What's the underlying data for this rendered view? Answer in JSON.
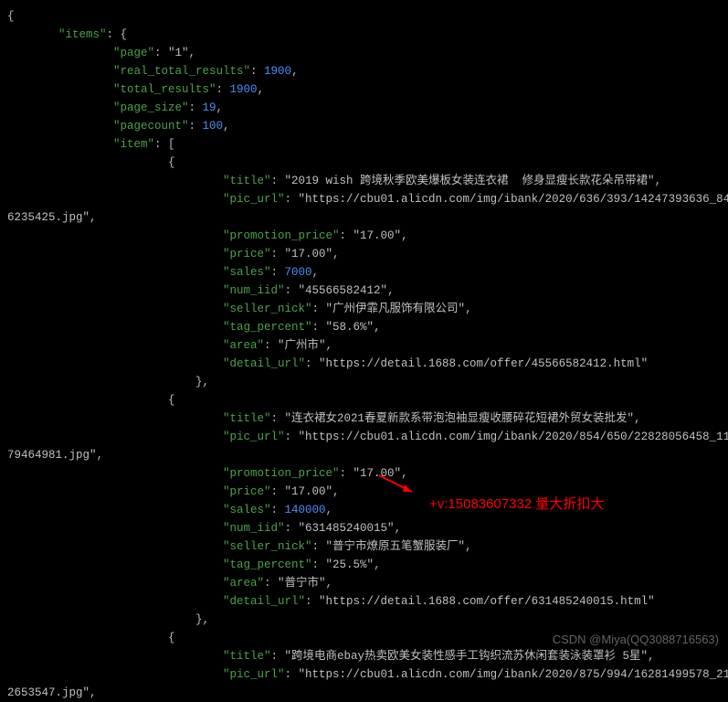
{
  "root": {
    "open": "{",
    "items_key": "\"items\"",
    "colon_obj": ": {",
    "page_key": "\"page\"",
    "page_val": "\"1\"",
    "rtr_key": "\"real_total_results\"",
    "rtr_val": "1900",
    "tr_key": "\"total_results\"",
    "tr_val": "1900",
    "ps_key": "\"page_size\"",
    "ps_val": "19",
    "pc_key": "\"pagecount\"",
    "pc_val": "100",
    "item_key": "\"item\"",
    "arr_open": ": [",
    "obj_open": "{",
    "obj_close": "},"
  },
  "item1": {
    "title_k": "\"title\"",
    "title_v": "\"2019 wish 跨境秋季欧美爆板女装连衣裙  修身显瘦长款花朵吊带裙\"",
    "pic_k": "\"pic_url\"",
    "pic_v1": "\"https://cbu01.alicdn.com/img/ibank/2020/636/393/14247393636_84",
    "pic_v2": "6235425.jpg\"",
    "pp_k": "\"promotion_price\"",
    "pp_v": "\"17.00\"",
    "price_k": "\"price\"",
    "price_v": "\"17.00\"",
    "sales_k": "\"sales\"",
    "sales_v": "7000",
    "numiid_k": "\"num_iid\"",
    "numiid_v": "\"45566582412\"",
    "sn_k": "\"seller_nick\"",
    "sn_v": "\"广州伊霏凡服饰有限公司\"",
    "tp_k": "\"tag_percent\"",
    "tp_v": "\"58.6%\"",
    "area_k": "\"area\"",
    "area_v": "\"广州市\"",
    "du_k": "\"detail_url\"",
    "du_v": "\"https://detail.1688.com/offer/45566582412.html\""
  },
  "item2": {
    "title_k": "\"title\"",
    "title_v": "\"连衣裙女2021春夏新款系带泡泡袖显瘦收腰碎花短裙外贸女装批发\"",
    "pic_k": "\"pic_url\"",
    "pic_v1": "\"https://cbu01.alicdn.com/img/ibank/2020/854/650/22828056458_11",
    "pic_v2": "79464981.jpg\"",
    "pp_k": "\"promotion_price\"",
    "pp_v": "\"17.00\"",
    "price_k": "\"price\"",
    "price_v": "\"17.00\"",
    "sales_k": "\"sales\"",
    "sales_v": "140000",
    "numiid_k": "\"num_iid\"",
    "numiid_v": "\"631485240015\"",
    "sn_k": "\"seller_nick\"",
    "sn_v": "\"普宁市燎原五笔蟹服装厂\"",
    "tp_k": "\"tag_percent\"",
    "tp_v": "\"25.5%\"",
    "area_k": "\"area\"",
    "area_v": "\"普宁市\"",
    "du_k": "\"detail_url\"",
    "du_v": "\"https://detail.1688.com/offer/631485240015.html\""
  },
  "item3": {
    "title_k": "\"title\"",
    "title_v": "\"跨境电商ebay热卖欧美女装性感手工钩织流苏休闲套装泳装罩衫 5星\"",
    "pic_k": "\"pic_url\"",
    "pic_v1": "\"https://cbu01.alicdn.com/img/ibank/2020/875/994/16281499578_21",
    "pic_v2": "2653547.jpg\""
  },
  "overlay": {
    "text": "+v:15083607332 量大折扣大",
    "watermark": "CSDN @Miya(QQ3088716563)"
  }
}
